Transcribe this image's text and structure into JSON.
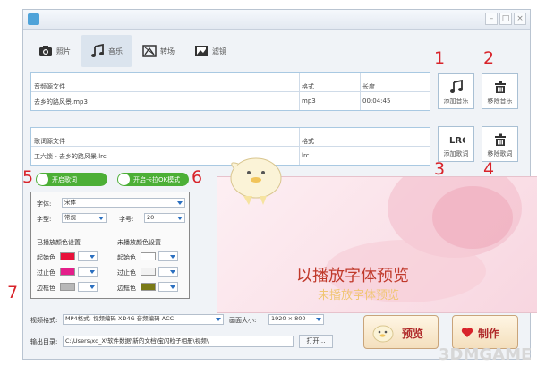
{
  "window": {
    "title": "",
    "controls": [
      "–",
      "□",
      "×"
    ]
  },
  "tabs": [
    {
      "label": "照片",
      "icon": "camera-icon",
      "active": false
    },
    {
      "label": "音乐",
      "icon": "music-note-icon",
      "active": true
    },
    {
      "label": "转场",
      "icon": "transition-icon",
      "active": false
    },
    {
      "label": "滤镜",
      "icon": "image-filter-icon",
      "active": false
    }
  ],
  "music_table": {
    "headers": [
      "音频源文件",
      "格式",
      "长度"
    ],
    "rows": [
      [
        "去乡的路风景.mp3",
        "mp3",
        "00:04:45"
      ]
    ]
  },
  "lyrics_table": {
    "headers": [
      "歌词源文件",
      "格式"
    ],
    "rows": [
      [
        "工六锁 - 去乡的路风景.lrc",
        "lrc"
      ]
    ]
  },
  "side_buttons": {
    "add_music": "添加音乐",
    "remove_music": "移除音乐",
    "add_lyrics": "添加歌词",
    "remove_lyrics": "移除歌词"
  },
  "annotations": [
    "1",
    "2",
    "3",
    "4",
    "5",
    "6",
    "7"
  ],
  "toggles": {
    "lyrics_on": "开启歌词",
    "karaoke_on": "开启卡拉OK模式"
  },
  "font_panel": {
    "font_label": "字体:",
    "font_value": "宋体",
    "style_label": "字型:",
    "style_value": "常规",
    "size_label": "字号:",
    "size_value": "20",
    "played_title": "已播放颜色设置",
    "unplayed_title": "未播放颜色设置",
    "start_label": "起始色",
    "end_label": "过止色",
    "border_label": "边框色",
    "colors": {
      "played_start": "#e8123a",
      "played_end": "#e41e8a",
      "played_border": "#b8b8b8",
      "unplayed_start": "#ffffff",
      "unplayed_end": "#f2f2f2",
      "unplayed_border": "#7a7a16"
    }
  },
  "preview": {
    "played_text": "以播放字体预览",
    "unplayed_text": "未播放字体预览",
    "played_color": "#c0392b",
    "unplayed_color": "#f0c674"
  },
  "bottom": {
    "video_format_label": "视频格式:",
    "video_format_value": "MP4格式: 视频编码 XD4G 音频编码 ACC",
    "size_label": "画面大小:",
    "size_value": "1920 × 800",
    "output_label": "输出目录:",
    "output_path": "C:\\Users\\xd_X\\软件数据\\新的文档\\宝闪粒子相册\\视频\\",
    "open_button": "打开…",
    "preview_button": "预览",
    "make_button": "制作"
  },
  "watermark": "3DMGAME"
}
